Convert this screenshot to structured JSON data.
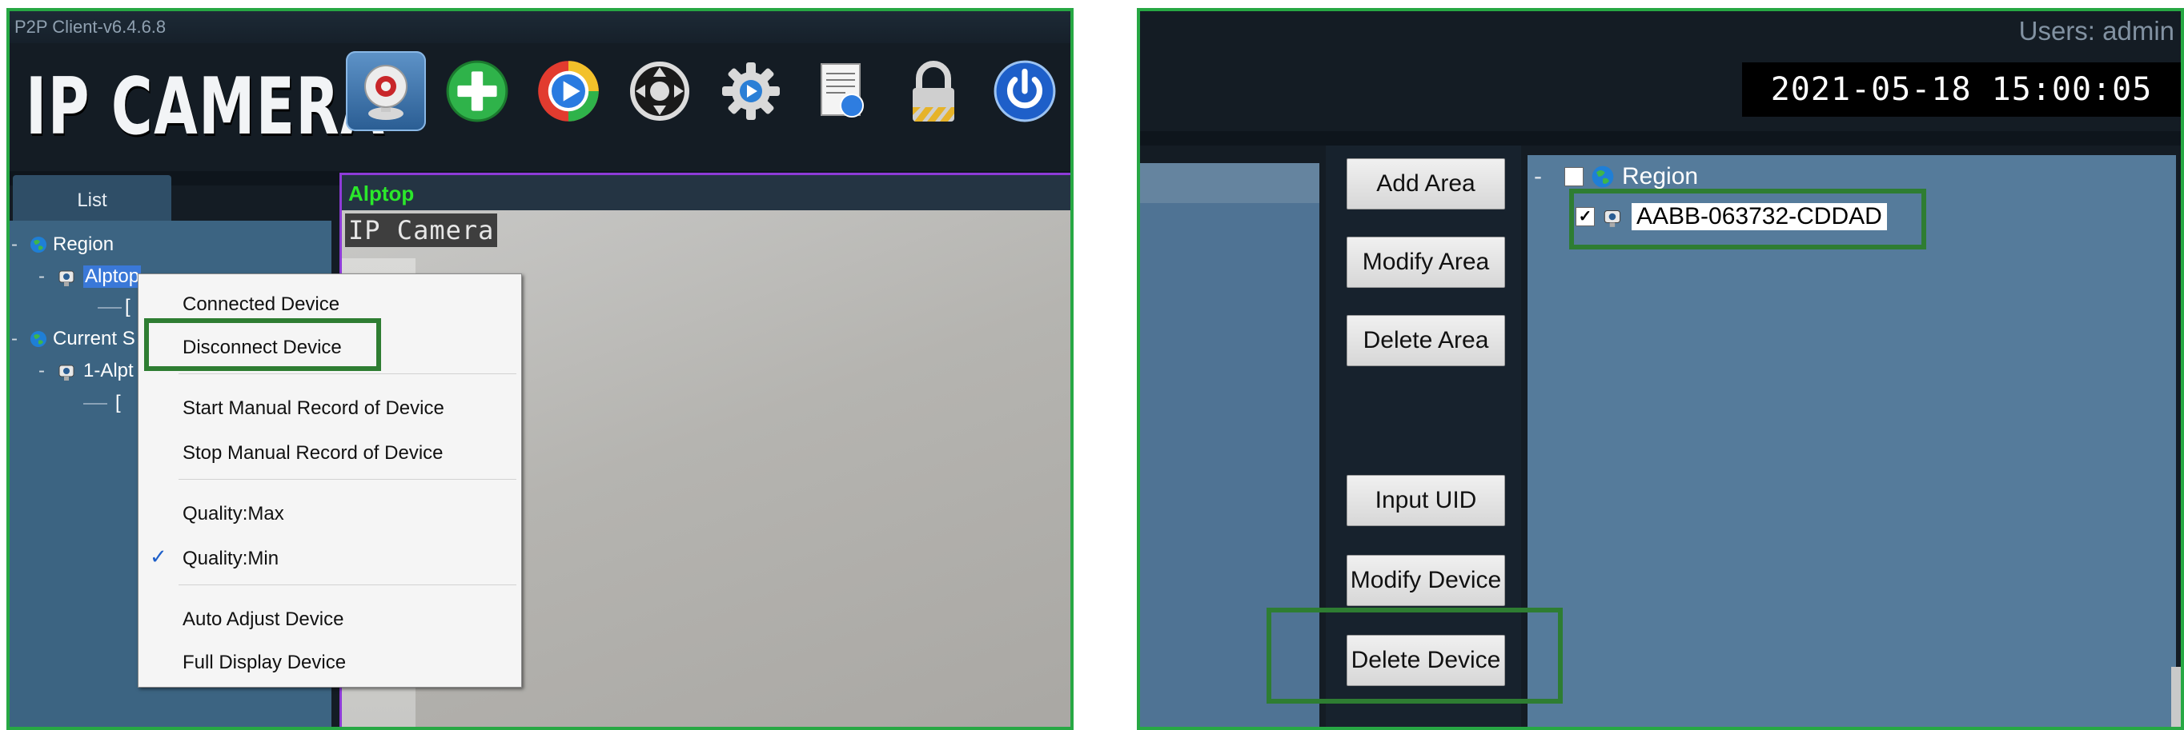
{
  "left": {
    "window_title": "P2P Client-v6.4.6.8",
    "brand": "IP CAMERA",
    "toolbar": [
      {
        "name": "webcam-icon",
        "active": true
      },
      {
        "name": "add-icon"
      },
      {
        "name": "playback-icon"
      },
      {
        "name": "ptz-icon"
      },
      {
        "name": "settings-icon"
      },
      {
        "name": "log-icon"
      },
      {
        "name": "lock-icon"
      },
      {
        "name": "power-icon"
      }
    ],
    "list_tab": "List",
    "tree": {
      "region_label": "Region",
      "device_label": "Alptop",
      "bracket": "[",
      "current_label": "Current S",
      "device2_label": "1-Alpt",
      "bracket2": "["
    },
    "video": {
      "header": "Alptop",
      "overlay": "IP Camera"
    },
    "context_menu": {
      "items": [
        "Connected Device",
        "Disconnect Device",
        "Start Manual Record of Device",
        "Stop Manual Record of Device",
        "Quality:Max",
        "Quality:Min",
        "Auto Adjust Device",
        "Full Display Device"
      ],
      "checked_item": "Quality:Min",
      "check_glyph": "✓"
    }
  },
  "right": {
    "users": "Users: admin",
    "datetime": "2021-05-18 15:00:05",
    "buttons": {
      "add_area": "Add Area",
      "modify_area": "Modify Area",
      "delete_area": "Delete Area",
      "input_uid": "Input UID",
      "modify_device": "Modify Device",
      "delete_device": "Delete Device"
    },
    "tree": {
      "root": "Region",
      "device_uid": "AABB-063732-CDDAD",
      "device_checked": true
    }
  },
  "colors": {
    "highlight_box": "#2e7d32",
    "panel_border": "#27a844",
    "video_header_text": "#2be82b"
  }
}
